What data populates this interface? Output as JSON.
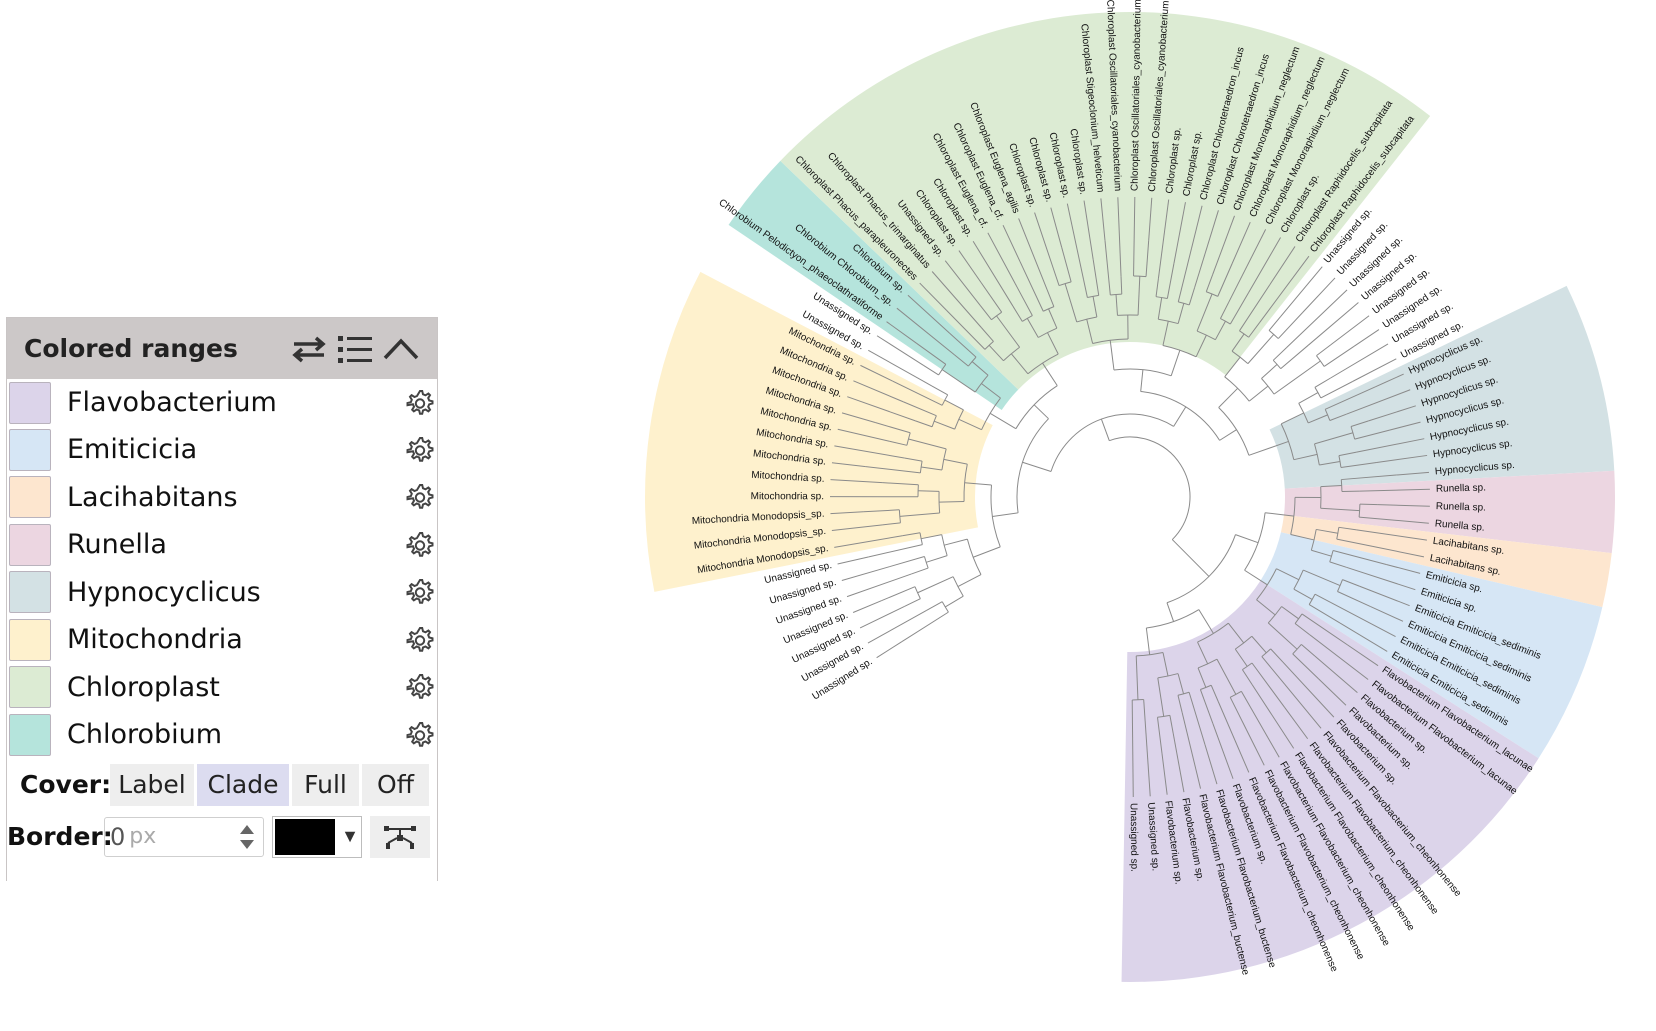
{
  "panel": {
    "title": "Colored ranges",
    "header_icons": [
      "swap-icon",
      "list-icon",
      "collapse-icon"
    ],
    "ranges": [
      {
        "label": "Flavobacterium",
        "color": "#dcd4ea"
      },
      {
        "label": "Emiticicia",
        "color": "#d6e6f5"
      },
      {
        "label": "Lacihabitans",
        "color": "#fde6cf"
      },
      {
        "label": "Runella",
        "color": "#ecd6e1"
      },
      {
        "label": "Hypnocyclicus",
        "color": "#d3e1e4"
      },
      {
        "label": "Mitochondria",
        "color": "#fef1cd"
      },
      {
        "label": "Chloroplast",
        "color": "#dcebd3"
      },
      {
        "label": "Chlorobium",
        "color": "#b5e4dc"
      }
    ],
    "cover": {
      "label": "Cover:",
      "options": [
        "Label",
        "Clade",
        "Full",
        "Off"
      ],
      "selected": "Clade"
    },
    "border": {
      "label": "Border:",
      "value": "0",
      "unit": "px",
      "color": "#000000"
    }
  },
  "tree": {
    "wedge_colors": {
      "Flavobacterium": "#dcd4ea",
      "Emiticicia": "#d6e6f5",
      "Lacihabitans": "#fde6cf",
      "Runella": "#ecd6e1",
      "Hypnocyclicus": "#d3e1e4",
      "Mitochondria": "#fef1cd",
      "Chloroplast": "#dcebd3",
      "Chlorobium": "#b5e4dc"
    },
    "leaves": [
      {
        "label": "Unassigned sp.",
        "group": ""
      },
      {
        "label": "Unassigned sp.",
        "group": ""
      },
      {
        "label": "Unassigned sp.",
        "group": ""
      },
      {
        "label": "Unassigned sp.",
        "group": ""
      },
      {
        "label": "Unassigned sp.",
        "group": ""
      },
      {
        "label": "Unassigned sp.",
        "group": ""
      },
      {
        "label": "Unassigned sp.",
        "group": ""
      },
      {
        "label": "Mitochondria Monodopsis_sp.",
        "group": "Mitochondria"
      },
      {
        "label": "Mitochondria Monodopsis_sp.",
        "group": "Mitochondria"
      },
      {
        "label": "Mitochondria Monodopsis_sp.",
        "group": "Mitochondria"
      },
      {
        "label": "Mitochondria sp.",
        "group": "Mitochondria"
      },
      {
        "label": "Mitochondria sp.",
        "group": "Mitochondria"
      },
      {
        "label": "Mitochondria sp.",
        "group": "Mitochondria"
      },
      {
        "label": "Mitochondria sp.",
        "group": "Mitochondria"
      },
      {
        "label": "Mitochondria sp.",
        "group": "Mitochondria"
      },
      {
        "label": "Mitochondria sp.",
        "group": "Mitochondria"
      },
      {
        "label": "Mitochondria sp.",
        "group": "Mitochondria"
      },
      {
        "label": "Mitochondria sp.",
        "group": "Mitochondria"
      },
      {
        "label": "Mitochondria sp.",
        "group": "Mitochondria"
      },
      {
        "label": "Unassigned sp.",
        "group": ""
      },
      {
        "label": "Unassigned sp.",
        "group": ""
      },
      {
        "label": "Chlorobium Pelodictyon_phaeoclathratiforme",
        "group": "Chlorobium"
      },
      {
        "label": "Chlorobium Chlorobium_sp.",
        "group": "Chlorobium"
      },
      {
        "label": "Chlorobium sp.",
        "group": "Chlorobium"
      },
      {
        "label": "Chloroplast Phacus_parapleuronectes",
        "group": "Chloroplast"
      },
      {
        "label": "Chloroplast Phacus_trimarginatus",
        "group": "Chloroplast"
      },
      {
        "label": "Unassigned sp.",
        "group": "Chloroplast"
      },
      {
        "label": "Chloroplast sp.",
        "group": "Chloroplast"
      },
      {
        "label": "Chloroplast sp.",
        "group": "Chloroplast"
      },
      {
        "label": "Chloroplast Euglena_cf.",
        "group": "Chloroplast"
      },
      {
        "label": "Chloroplast Euglena_cf.",
        "group": "Chloroplast"
      },
      {
        "label": "Chloroplast Euglena_agilis",
        "group": "Chloroplast"
      },
      {
        "label": "Chloroplast sp.",
        "group": "Chloroplast"
      },
      {
        "label": "Chloroplast sp.",
        "group": "Chloroplast"
      },
      {
        "label": "Chloroplast sp.",
        "group": "Chloroplast"
      },
      {
        "label": "Chloroplast sp.",
        "group": "Chloroplast"
      },
      {
        "label": "Chloroplast Stigeoclonium_helveticum",
        "group": "Chloroplast"
      },
      {
        "label": "Chloroplast Oscillatoriales_cyanobacterium",
        "group": "Chloroplast"
      },
      {
        "label": "Chloroplast Oscillatoriales_cyanobacterium",
        "group": "Chloroplast"
      },
      {
        "label": "Chloroplast Oscillatoriales_cyanobacterium",
        "group": "Chloroplast"
      },
      {
        "label": "Chloroplast sp.",
        "group": "Chloroplast"
      },
      {
        "label": "Chloroplast sp.",
        "group": "Chloroplast"
      },
      {
        "label": "Chloroplast Chlorotetraedron_incus",
        "group": "Chloroplast"
      },
      {
        "label": "Chloroplast Chlorotetraedron_incus",
        "group": "Chloroplast"
      },
      {
        "label": "Chloroplast Monoraphidium_neglectum",
        "group": "Chloroplast"
      },
      {
        "label": "Chloroplast Monoraphidium_neglectum",
        "group": "Chloroplast"
      },
      {
        "label": "Chloroplast Monoraphidium_neglectum",
        "group": "Chloroplast"
      },
      {
        "label": "Chloroplast sp.",
        "group": "Chloroplast"
      },
      {
        "label": "Chloroplast Raphidocelis_subcapitata",
        "group": "Chloroplast"
      },
      {
        "label": "Chloroplast Raphidocelis_subcapitata",
        "group": "Chloroplast"
      },
      {
        "label": "Unassigned sp.",
        "group": ""
      },
      {
        "label": "Unassigned sp.",
        "group": ""
      },
      {
        "label": "Unassigned sp.",
        "group": ""
      },
      {
        "label": "Unassigned sp.",
        "group": ""
      },
      {
        "label": "Unassigned sp.",
        "group": ""
      },
      {
        "label": "Unassigned sp.",
        "group": ""
      },
      {
        "label": "Unassigned sp.",
        "group": ""
      },
      {
        "label": "Unassigned sp.",
        "group": ""
      },
      {
        "label": "Hypnocyclicus sp.",
        "group": "Hypnocyclicus"
      },
      {
        "label": "Hypnocyclicus sp.",
        "group": "Hypnocyclicus"
      },
      {
        "label": "Hypnocyclicus sp.",
        "group": "Hypnocyclicus"
      },
      {
        "label": "Hypnocyclicus sp.",
        "group": "Hypnocyclicus"
      },
      {
        "label": "Hypnocyclicus sp.",
        "group": "Hypnocyclicus"
      },
      {
        "label": "Hypnocyclicus sp.",
        "group": "Hypnocyclicus"
      },
      {
        "label": "Hypnocyclicus sp.",
        "group": "Hypnocyclicus"
      },
      {
        "label": "Runella sp.",
        "group": "Runella"
      },
      {
        "label": "Runella sp.",
        "group": "Runella"
      },
      {
        "label": "Runella sp.",
        "group": "Runella"
      },
      {
        "label": "Lacihabitans sp.",
        "group": "Lacihabitans"
      },
      {
        "label": "Lacihabitans sp.",
        "group": "Lacihabitans"
      },
      {
        "label": "Emiticicia sp.",
        "group": "Emiticicia"
      },
      {
        "label": "Emiticicia sp.",
        "group": "Emiticicia"
      },
      {
        "label": "Emiticicia Emiticicia_sediminis",
        "group": "Emiticicia"
      },
      {
        "label": "Emiticicia Emiticicia_sediminis",
        "group": "Emiticicia"
      },
      {
        "label": "Emiticicia Emiticicia_sediminis",
        "group": "Emiticicia"
      },
      {
        "label": "Emiticicia Emiticicia_sediminis",
        "group": "Emiticicia"
      },
      {
        "label": "Flavobacterium Flavobacterium_lacunae",
        "group": "Flavobacterium"
      },
      {
        "label": "Flavobacterium Flavobacterium_lacunae",
        "group": "Flavobacterium"
      },
      {
        "label": "Flavobacterium sp.",
        "group": "Flavobacterium"
      },
      {
        "label": "Flavobacterium sp.",
        "group": "Flavobacterium"
      },
      {
        "label": "Flavobacterium sp.",
        "group": "Flavobacterium"
      },
      {
        "label": "Flavobacterium Flavobacterium_cheonhonense",
        "group": "Flavobacterium"
      },
      {
        "label": "Flavobacterium Flavobacterium_cheonhonense",
        "group": "Flavobacterium"
      },
      {
        "label": "Flavobacterium Flavobacterium_cheonhonense",
        "group": "Flavobacterium"
      },
      {
        "label": "Flavobacterium Flavobacterium_cheonhonense",
        "group": "Flavobacterium"
      },
      {
        "label": "Flavobacterium Flavobacterium_cheonhonense",
        "group": "Flavobacterium"
      },
      {
        "label": "Flavobacterium Flavobacterium_cheonhonense",
        "group": "Flavobacterium"
      },
      {
        "label": "Flavobacterium sp.",
        "group": "Flavobacterium"
      },
      {
        "label": "Flavobacterium Flavobacterium_buctense",
        "group": "Flavobacterium"
      },
      {
        "label": "Flavobacterium Flavobacterium_buctense",
        "group": "Flavobacterium"
      },
      {
        "label": "Flavobacterium sp.",
        "group": "Flavobacterium"
      },
      {
        "label": "Flavobacterium sp.",
        "group": "Flavobacterium"
      },
      {
        "label": "Unassigned sp.",
        "group": "Flavobacterium"
      },
      {
        "label": "Unassigned sp.",
        "group": "Flavobacterium"
      }
    ]
  }
}
